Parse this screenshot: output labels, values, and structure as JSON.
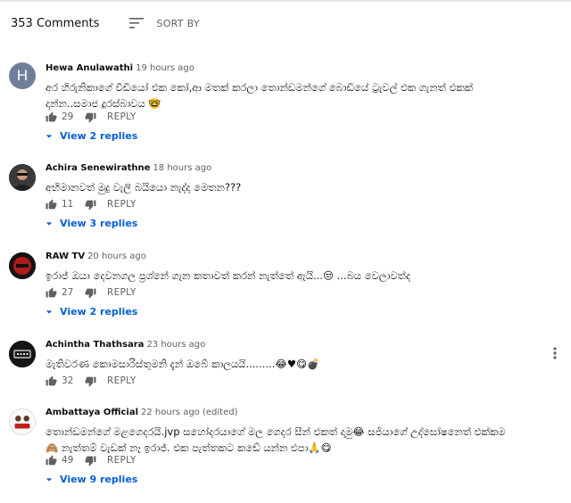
{
  "header": {
    "comment_count": "353 Comments",
    "sort_label": "SORT BY"
  },
  "action_label": "REPLY",
  "colors": {
    "link": "#065fd4",
    "muted": "#606060",
    "avatar_h": "#6f7f99"
  },
  "comments": [
    {
      "author": "Hewa Anulawathi",
      "time": "19 hours ago",
      "avatar": "H",
      "text": "අර හිරුනිකාගේ වීඩියෝ එක කෝ,ආ මතක් කරලා තොන්ඩමන්ගේ බොඩියේ ට්‍රැවල් එක ගැනත් එකක්\nදාන්න..සමාජ දූරස්බාවය 🤓",
      "likes": "29",
      "replies": "View 2 replies"
    },
    {
      "author": "Achira Senewirathne",
      "time": "18 hours ago",
      "avatar_icon": "person-avatar-icon",
      "text": "අභිමානවත් මුදු වැලි බයියො නැද්ද මෙතන???",
      "likes": "11",
      "replies": "View 3 replies"
    },
    {
      "author": "RAW TV",
      "time": "20 hours ago",
      "avatar_icon": "raw-tv-logo-icon",
      "text": "ඉරාජ් ඔයා දෙවනගල ප්‍රශ්නේ ගැන කතාවත් කරන් නැත්තේ ඇයි...😒 ...බය වෙලාවත්ද",
      "likes": "27",
      "replies": "View 2 replies"
    },
    {
      "author": "Achintha Thathsara",
      "time": "23 hours ago",
      "avatar_icon": "pubg-logo-icon",
      "text": "මැතිවරණ කොමසාරිස්තුමනි දැන් ඔබේ කාලයයි.........😂♥😋💣",
      "likes": "32"
    },
    {
      "author": "Ambattaya Official",
      "time": "22 hours ago (edited)",
      "avatar_icon": "ambattaya-logo-icon",
      "text": "තොන්ඩමන්ගේ මළගෙදරයි.jvp සහෝදරයාගේ මල ගෙදර සීන් එකත් දාමු😂 සජියාගේ උද්ඝෝෂනෙත් එක්කම\n🙈 නැත්තම් වැඩක් නෑ ඉරාජ්. එක පැත්තකට කඩේ යන්න එපා🙏😋",
      "likes": "49",
      "replies": "View 9 replies"
    }
  ]
}
